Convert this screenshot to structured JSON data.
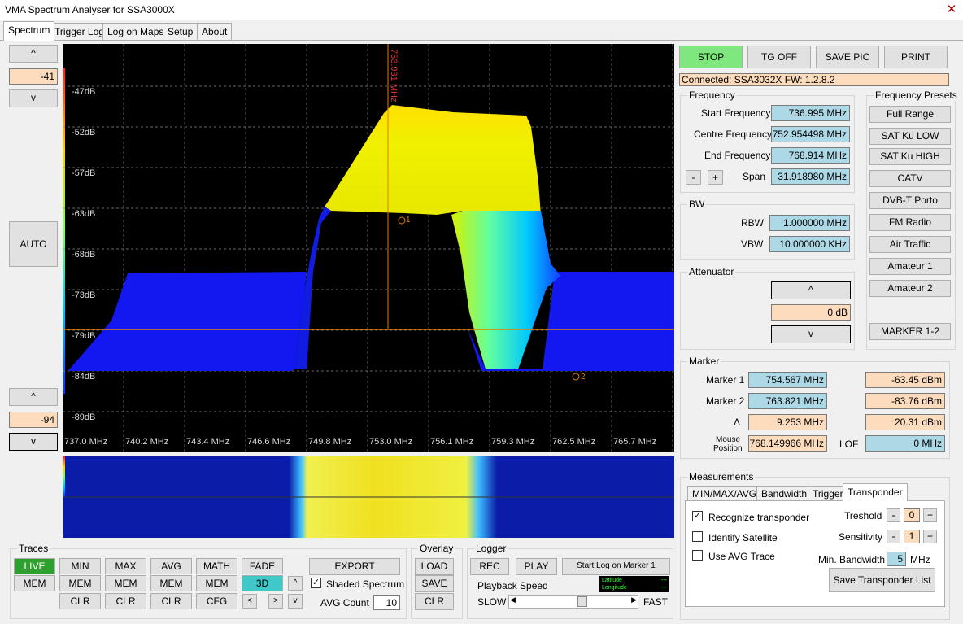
{
  "window": {
    "title": "VMA Spectrum Analyser for SSA3000X",
    "close": "✕"
  },
  "tabs": [
    "Spectrum",
    "Trigger Log",
    "Log on Maps",
    "Setup",
    "About"
  ],
  "left": {
    "up": "^",
    "ref_top": "-41",
    "down": "v",
    "auto": "AUTO",
    "up2": "^",
    "ref_bottom": "-94",
    "down2": "v"
  },
  "spectrum": {
    "y_labels": [
      "-47dB",
      "-52dB",
      "-57dB",
      "-63dB",
      "-68dB",
      "-73dB",
      "-79dB",
      "-84dB",
      "-89dB"
    ],
    "x_labels": [
      "737.0 MHz",
      "740.2 MHz",
      "743.4 MHz",
      "746.6 MHz",
      "749.8 MHz",
      "753.0 MHz",
      "756.1 MHz",
      "759.3 MHz",
      "762.5 MHz",
      "765.7 MHz"
    ],
    "cursor_label": "753.931 MHz",
    "marker1": "1",
    "marker2": "2"
  },
  "colors": {
    "stop": "#7ee87e",
    "peach": "#fcdcbc",
    "blue": "#add8e6",
    "cyan_btn": "#40c8c8",
    "live": "#2ea02e"
  },
  "toolbar": {
    "stop": "STOP",
    "tg": "TG OFF",
    "save_pic": "SAVE PIC",
    "print": "PRINT"
  },
  "status": "Connected: SSA3032X FW: 1.2.8.2",
  "frequency": {
    "title": "Frequency",
    "start_label": "Start Frequency",
    "start": "736.995 MHz",
    "centre_label": "Centre Frequency",
    "centre": "752.954498 MHz",
    "end_label": "End Frequency",
    "end": "768.914 MHz",
    "minus": "-",
    "plus": "+",
    "span_label": "Span",
    "span": "31.918980 MHz"
  },
  "bw": {
    "title": "BW",
    "rbw_label": "RBW",
    "rbw": "1.000000 MHz",
    "vbw_label": "VBW",
    "vbw": "10.000000 KHz"
  },
  "attenuator": {
    "title": "Attenuator",
    "up": "^",
    "value": "0 dB",
    "down": "v"
  },
  "presets": {
    "title": "Frequency Presets",
    "items": [
      "Full Range",
      "SAT Ku LOW",
      "SAT Ku HIGH",
      "CATV",
      "DVB-T Porto",
      "FM Radio",
      "Air Traffic",
      "Amateur 1",
      "Amateur 2"
    ],
    "marker_btn": "MARKER 1-2"
  },
  "marker": {
    "title": "Marker",
    "m1_label": "Marker 1",
    "m1_freq": "754.567 MHz",
    "m1_dbm": "-63.45 dBm",
    "m2_label": "Marker 2",
    "m2_freq": "763.821 MHz",
    "m2_dbm": "-83.76 dBm",
    "delta_label": "Δ",
    "delta_freq": "9.253 MHz",
    "delta_dbm": "20.31 dBm",
    "mouse_label1": "Mouse",
    "mouse_label2": "Position",
    "mouse_freq": "768.149966 MHz",
    "lof_label": "LOF",
    "lof": "0 MHz"
  },
  "measurements": {
    "title": "Measurements",
    "tabs": [
      "MIN/MAX/AVG",
      "Bandwidth",
      "Trigger",
      "Transponder"
    ],
    "recognize": "Recognize transponder",
    "identify": "Identify Satellite",
    "use_avg": "Use AVG Trace",
    "treshold_label": "Treshold",
    "treshold": "0",
    "sensitivity_label": "Sensitivity",
    "sensitivity": "1",
    "minbw_label": "Min. Bandwidth",
    "minbw": "5",
    "minbw_unit": "MHz",
    "save_list": "Save Transponder List",
    "minus": "-",
    "plus": "+",
    "check": "✓"
  },
  "traces": {
    "title": "Traces",
    "row1": [
      "LIVE",
      "MIN",
      "MAX",
      "AVG",
      "MATH",
      "FADE"
    ],
    "row2": [
      "MEM",
      "MEM",
      "MEM",
      "MEM",
      "MEM",
      "3D"
    ],
    "row3": [
      "CLR",
      "CLR",
      "CLR",
      "CFG"
    ],
    "export": "EXPORT",
    "shaded": "Shaded Spectrum",
    "avg_count_label": "AVG Count",
    "avg_count": "10",
    "left": "<",
    "right": ">",
    "up": "^",
    "down": "v"
  },
  "overlay": {
    "title": "Overlay",
    "load": "LOAD",
    "save": "SAVE",
    "clr": "CLR"
  },
  "logger": {
    "title": "Logger",
    "rec": "REC",
    "play": "PLAY",
    "start_log": "Start Log on Marker 1",
    "playback": "Playback Speed",
    "slow": "SLOW",
    "fast": "FAST",
    "latitude": "Latitude",
    "longitude": "Longitude",
    "lat_val": "---",
    "lon_val": "---",
    "speed_fraction": 0.55
  }
}
